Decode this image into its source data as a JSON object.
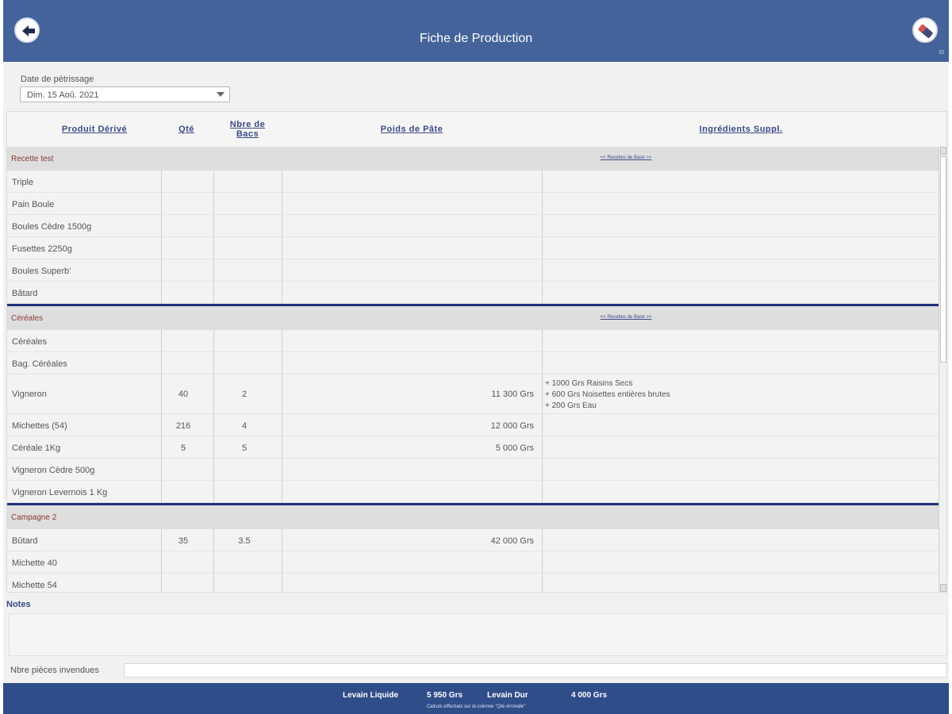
{
  "header": {
    "title": "Fiche de Production",
    "back_icon": "arrow-left-icon",
    "eraser_icon": "eraser-icon",
    "version": "31"
  },
  "date": {
    "label": "Date de pétrissage",
    "value": "Dim. 15 Aoû. 2021"
  },
  "table": {
    "columns": [
      "Produit Dérivé",
      "Qté",
      "Nbre de Bacs",
      "Poids de Pâte",
      "Ingrédients Suppl."
    ],
    "sections": [
      {
        "name": "Recette test",
        "link": "<< Recettes de Base >>",
        "rows": [
          {
            "name": "Triple",
            "qty": "",
            "bacs": "",
            "poids": "",
            "ingr": []
          },
          {
            "name": "Pain Boule",
            "qty": "",
            "bacs": "",
            "poids": "",
            "ingr": []
          },
          {
            "name": "Boules Cèdre 1500g",
            "qty": "",
            "bacs": "",
            "poids": "",
            "ingr": []
          },
          {
            "name": "Fusettes 2250g",
            "qty": "",
            "bacs": "",
            "poids": "",
            "ingr": []
          },
          {
            "name": "Boules Superb'",
            "qty": "",
            "bacs": "",
            "poids": "",
            "ingr": []
          },
          {
            "name": "Bâtard",
            "qty": "",
            "bacs": "",
            "poids": "",
            "ingr": []
          }
        ]
      },
      {
        "name": "Céréales",
        "link": "<< Recettes de Base >>",
        "rows": [
          {
            "name": "Céréales",
            "qty": "",
            "bacs": "",
            "poids": "",
            "ingr": []
          },
          {
            "name": "Bag. Céréales",
            "qty": "",
            "bacs": "",
            "poids": "",
            "ingr": []
          },
          {
            "name": "Vigneron",
            "qty": "40",
            "bacs": "2",
            "poids": "11 300 Grs",
            "ingr": [
              "+ 1000 Grs Raisins Secs",
              "+ 600 Grs Noisettes entières brutes",
              "+ 200 Grs Eau"
            ]
          },
          {
            "name": "Michettes (54)",
            "qty": "216",
            "bacs": "4",
            "poids": "12 000 Grs",
            "ingr": []
          },
          {
            "name": "Céréale 1Kg",
            "qty": "5",
            "bacs": "5",
            "poids": "5 000 Grs",
            "ingr": []
          },
          {
            "name": "Vigneron Cèdre 500g",
            "qty": "",
            "bacs": "",
            "poids": "",
            "ingr": []
          },
          {
            "name": "Vigneron Levernois 1 Kg",
            "qty": "",
            "bacs": "",
            "poids": "",
            "ingr": []
          }
        ]
      },
      {
        "name": "Campagne 2",
        "link": "",
        "rows": [
          {
            "name": "Bûtard",
            "qty": "35",
            "bacs": "3.5",
            "poids": "42 000 Grs",
            "ingr": []
          },
          {
            "name": "Michette 40",
            "qty": "",
            "bacs": "",
            "poids": "",
            "ingr": []
          },
          {
            "name": "Michette 54",
            "qty": "",
            "bacs": "",
            "poids": "",
            "ingr": []
          }
        ]
      }
    ]
  },
  "notes": {
    "label": "Notes",
    "value": ""
  },
  "unsold": {
    "label": "Nbre pièces invendues",
    "value": ""
  },
  "footer": {
    "levain_liquide_label": "Levain Liquide",
    "levain_liquide_value": "5 950 Grs",
    "levain_dur_label": "Levain Dur",
    "levain_dur_value": "4 000 Grs",
    "note": "Calculs effectués sur la colonne \"Qté Arrondie\""
  },
  "colors": {
    "header": "#44639a",
    "footer": "#2f4d89",
    "section_name": "#8a3a33",
    "link": "#3b4a86",
    "separator": "#20317a"
  }
}
